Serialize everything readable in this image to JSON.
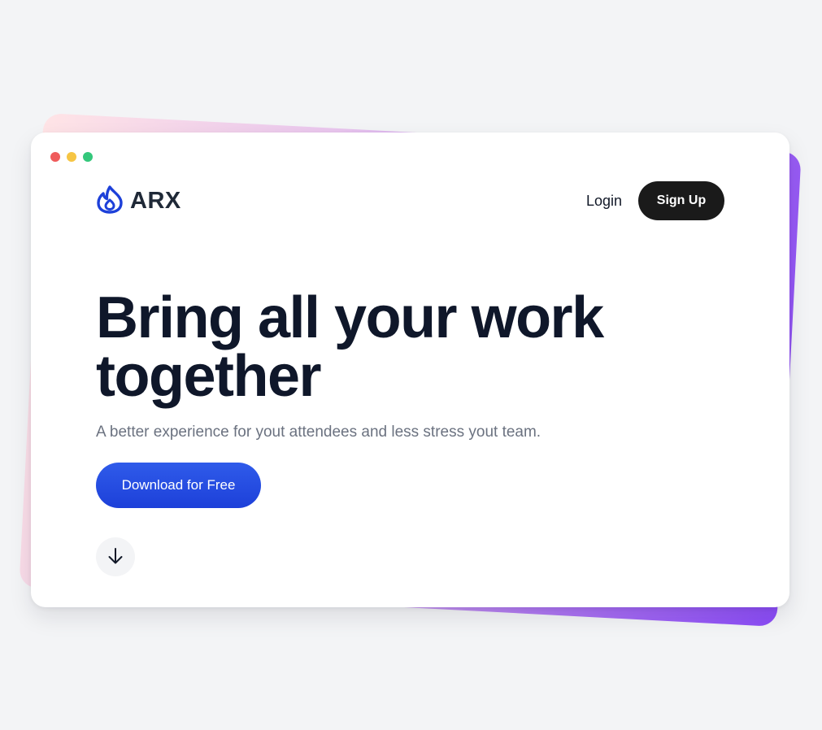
{
  "brand": {
    "name": "ARX",
    "logo_icon": "flame-icon",
    "logo_color": "#1d40d9"
  },
  "window_controls": {
    "colors": [
      "#ef5b5b",
      "#f6c544",
      "#34c77b"
    ]
  },
  "nav": {
    "login_label": "Login",
    "signup_label": "Sign Up"
  },
  "hero": {
    "headline_line1": "Bring all your work",
    "headline_line2": "together",
    "subtitle": "A better experience for yout attendees and less stress yout team.",
    "cta_label": "Download for Free",
    "scroll_icon": "arrow-down-icon"
  },
  "colors": {
    "accent": "#1d40d9",
    "dark_button": "#1a1a1a",
    "headline": "#0f172a",
    "subtitle": "#6b7280"
  }
}
